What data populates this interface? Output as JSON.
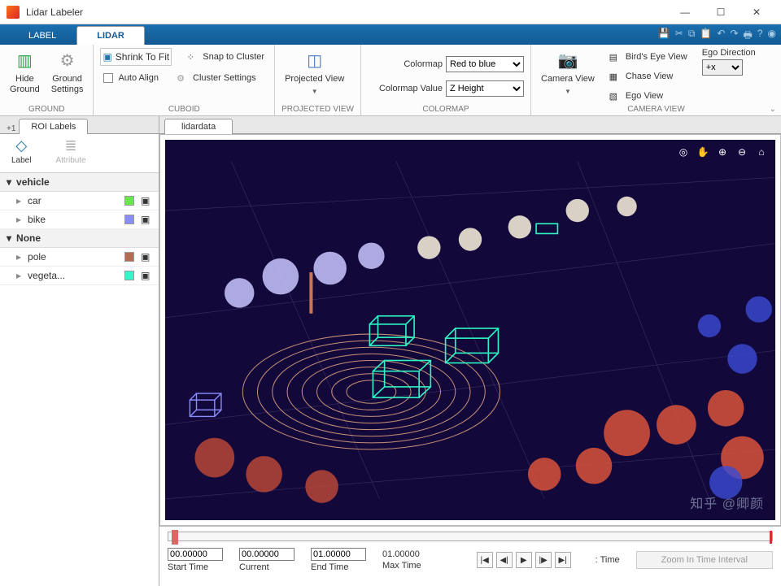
{
  "app": {
    "title": "Lidar Labeler"
  },
  "tabs": {
    "label": "LABEL",
    "lidar": "LIDAR"
  },
  "ribbon": {
    "ground": {
      "title": "GROUND",
      "hide": "Hide\nGround",
      "settings": "Ground\nSettings"
    },
    "cuboid": {
      "title": "CUBOID",
      "shrink": "Shrink To Fit",
      "autoalign": "Auto Align",
      "snap": "Snap to Cluster",
      "cluster": "Cluster Settings"
    },
    "projected": {
      "title": "PROJECTED VIEW",
      "btn": "Projected View"
    },
    "colormap": {
      "title": "COLORMAP",
      "cmap_label": "Colormap",
      "cmap_val": "Red to blue",
      "cval_label": "Colormap Value",
      "cval_val": "Z Height"
    },
    "camera": {
      "title": "CAMERA VIEW",
      "btn": "Camera View",
      "bev": "Bird's Eye View",
      "chase": "Chase View",
      "ego": "Ego View",
      "egodir_label": "Ego Direction",
      "egodir_val": "+x"
    }
  },
  "left": {
    "tab": "ROI Labels",
    "label_btn": "Label",
    "attr_btn": "Attribute",
    "groups": [
      {
        "name": "vehicle",
        "items": [
          {
            "name": "car",
            "color": "#67e84b"
          },
          {
            "name": "bike",
            "color": "#8a8cff"
          }
        ]
      },
      {
        "name": "None",
        "items": [
          {
            "name": "pole",
            "color": "#b96a52"
          },
          {
            "name": "vegeta...",
            "color": "#37f5c9"
          }
        ]
      }
    ]
  },
  "viewer": {
    "tab": "lidardata"
  },
  "timeline": {
    "start_label": "Start Time",
    "start_val": "00.00000",
    "current_label": "Current",
    "current_val": "00.00000",
    "end_label": "End Time",
    "end_val": "01.00000",
    "max_label": "Max Time",
    "max_val": "01.00000",
    "pt_label": ": Time",
    "zoom_label": "Zoom In Time Interval"
  },
  "watermark": "知乎 @卿颜"
}
